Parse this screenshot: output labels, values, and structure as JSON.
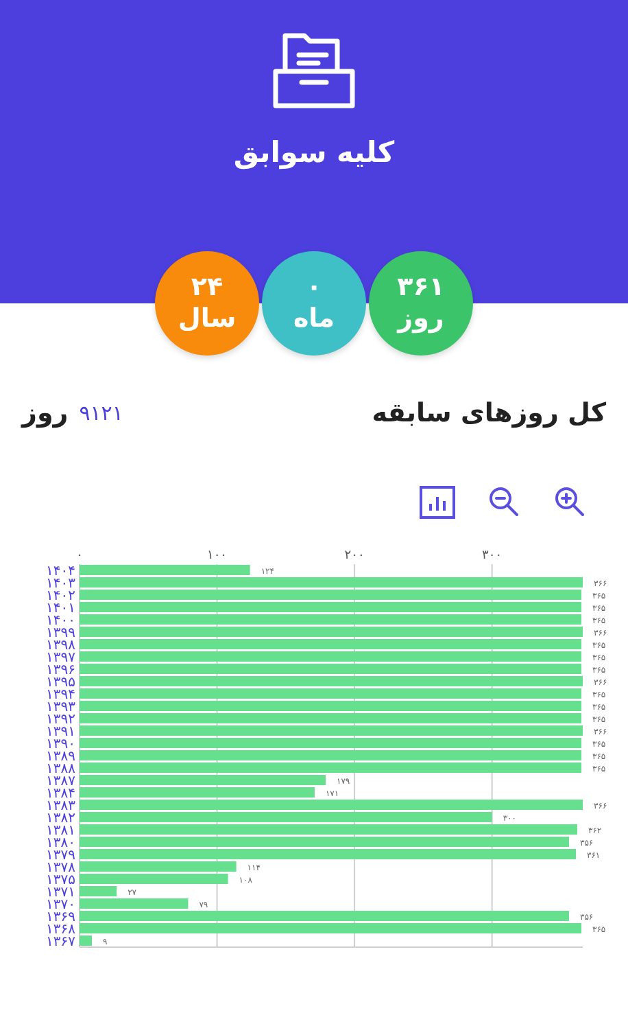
{
  "header": {
    "title": "کلیه سوابق"
  },
  "stats": [
    {
      "value": "۳۶۱",
      "unit": "روز",
      "color": "#3cc46a"
    },
    {
      "value": "۰",
      "unit": "ماه",
      "color": "#3fbfc6"
    },
    {
      "value": "۲۴",
      "unit": "سال",
      "color": "#f88a0c"
    }
  ],
  "total": {
    "label": "کل روزهای سابقه",
    "value": "۹۱۲۱",
    "unit": "روز"
  },
  "chart": {
    "chart_data": {
      "type": "bar",
      "orientation": "horizontal",
      "categories": [
        "۱۴۰۴",
        "۱۴۰۳",
        "۱۴۰۲",
        "۱۴۰۱",
        "۱۴۰۰",
        "۱۳۹۹",
        "۱۳۹۸",
        "۱۳۹۷",
        "۱۳۹۶",
        "۱۳۹۵",
        "۱۳۹۴",
        "۱۳۹۳",
        "۱۳۹۲",
        "۱۳۹۱",
        "۱۳۹۰",
        "۱۳۸۹",
        "۱۳۸۸",
        "۱۳۸۷",
        "۱۳۸۴",
        "۱۳۸۳",
        "۱۳۸۲",
        "۱۳۸۱",
        "۱۳۸۰",
        "۱۳۷۹",
        "۱۳۷۸",
        "۱۳۷۵",
        "۱۳۷۱",
        "۱۳۷۰",
        "۱۳۶۹",
        "۱۳۶۸",
        "۱۳۶۷"
      ],
      "grid": true,
      "series": [
        {
          "color": "#66e08e",
          "values": [
            124,
            366,
            365,
            365,
            365,
            366,
            365,
            365,
            365,
            366,
            365,
            365,
            365,
            366,
            365,
            365,
            365,
            179,
            171,
            366,
            300,
            362,
            356,
            361,
            114,
            108,
            27,
            79,
            356,
            365,
            9
          ]
        }
      ],
      "value_labels": [
        "۱۲۴",
        "۳۶۶",
        "۳۶۵",
        "۳۶۵",
        "۳۶۵",
        "۳۶۶",
        "۳۶۵",
        "۳۶۵",
        "۳۶۵",
        "۳۶۶",
        "۳۶۵",
        "۳۶۵",
        "۳۶۵",
        "۳۶۶",
        "۳۶۵",
        "۳۶۵",
        "۳۶۵",
        "۱۷۹",
        "۱۷۱",
        "۳۶۶",
        "۳۰۰",
        "۳۶۲",
        "۳۵۶",
        "۳۶۱",
        "۱۱۴",
        "۱۰۸",
        "۲۷",
        "۷۹",
        "۳۵۶",
        "۳۶۵",
        "۹"
      ],
      "xlim": [
        0,
        366
      ],
      "xticks": [
        {
          "value": 0,
          "label": "۰"
        },
        {
          "value": 100,
          "label": "۱۰۰"
        },
        {
          "value": 200,
          "label": "۲۰۰"
        },
        {
          "value": 300,
          "label": "۳۰۰"
        }
      ]
    }
  }
}
